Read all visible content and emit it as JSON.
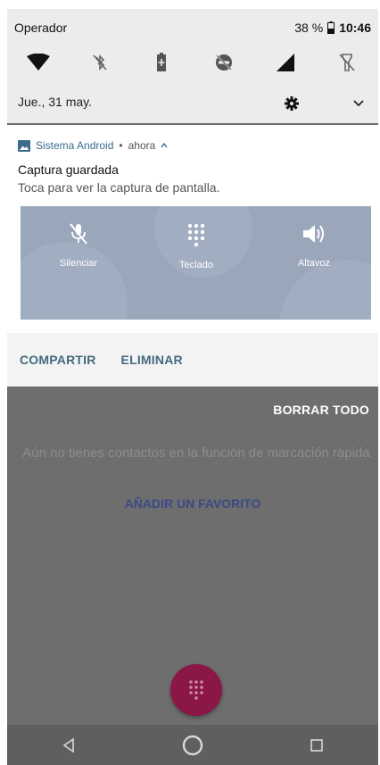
{
  "status_bar": {
    "carrier": "Operador",
    "battery": "38 %",
    "time": "10:46"
  },
  "quick_settings": {
    "icons": [
      "wifi-icon",
      "bluetooth-off-icon",
      "battery-saver-icon",
      "do-not-disturb-off-icon",
      "cell-signal-icon",
      "flashlight-off-icon"
    ]
  },
  "date_row": {
    "date": "Jue., 31 may."
  },
  "notification": {
    "app_name": "Sistema Android",
    "separator": "•",
    "when": "ahora",
    "title": "Captura guardada",
    "text": "Toca para ver la captura de pantalla.",
    "preview": {
      "mute_label": "Silenciar",
      "keypad_label": "Teclado",
      "speaker_label": "Altavoz"
    },
    "actions": {
      "share": "COMPARTIR",
      "delete": "ELIMINAR"
    }
  },
  "background_app": {
    "clear_all": "BORRAR TODO",
    "empty_message": "Aún no tienes contactos en la función de marcación rápida",
    "add_favorite": "AÑADIR UN FAVORITO"
  },
  "colors": {
    "accent": "#8b1746",
    "notif_accent": "#3a6b8a",
    "preview_bg": "#9aa7bb"
  }
}
